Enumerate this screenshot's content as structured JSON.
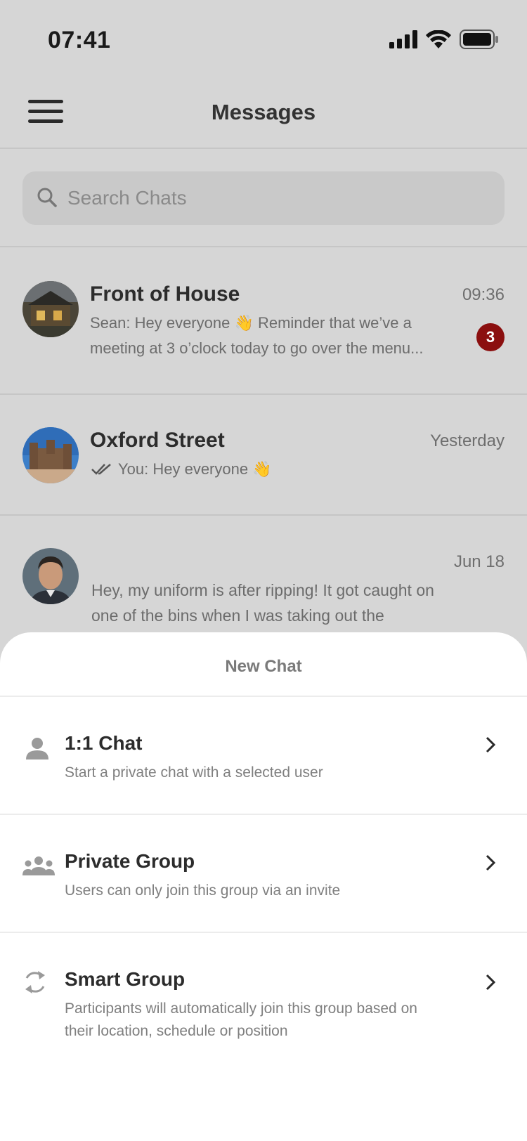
{
  "status_bar": {
    "time": "07:41"
  },
  "header": {
    "title": "Messages"
  },
  "search": {
    "placeholder": "Search Chats"
  },
  "chats": [
    {
      "name": "Front of House",
      "time": "09:36",
      "preview": "Sean: Hey everyone 👋 Reminder that we’ve a meeting at 3 o’clock today to go over the menu...",
      "unread": "3"
    },
    {
      "name": "Oxford Street",
      "time": "Yesterday",
      "preview": "You: Hey everyone 👋"
    },
    {
      "name": "",
      "time": "Jun 18",
      "preview": "Hey, my uniform is after ripping! It got caught on one of the bins when I was taking out the"
    }
  ],
  "new_chat_sheet": {
    "title": "New Chat",
    "options": [
      {
        "label": "1:1 Chat",
        "description": "Start a private chat with a selected user",
        "icon": "person-icon"
      },
      {
        "label": "Private Group",
        "description": "Users can only join this group via an invite",
        "icon": "group-icon"
      },
      {
        "label": "Smart Group",
        "description": "Participants will automatically join this group based on their location, schedule or position",
        "icon": "sync-icon"
      }
    ]
  },
  "colors": {
    "badge": "#8b0f0f",
    "background_dim": "#d6d6d6",
    "sheet": "#ffffff"
  }
}
